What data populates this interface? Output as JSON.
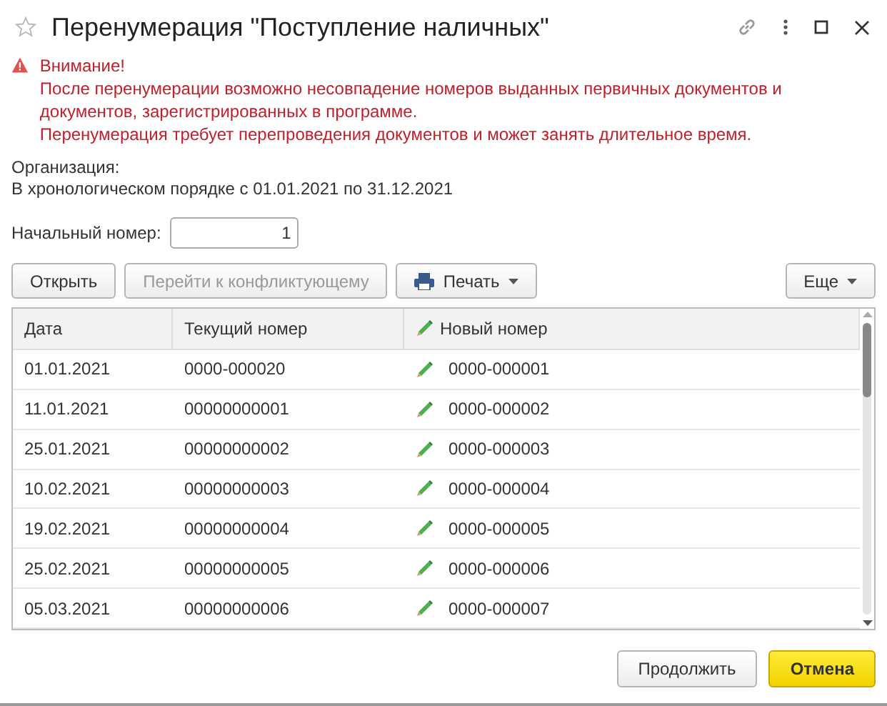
{
  "window": {
    "title": "Перенумерация \"Поступление наличных\""
  },
  "warning": {
    "lines": [
      "Внимание!",
      "После перенумерации возможно несовпадение номеров выданных первичных документов и документов, зарегистрированных в программе.",
      "Перенумерация требует перепроведения документов и может занять длительное время."
    ]
  },
  "organization": {
    "label": "Организация:"
  },
  "period": "В хронологическом порядке с 01.01.2021 по 31.12.2021",
  "start_number": {
    "label": "Начальный номер:",
    "value": "1"
  },
  "toolbar": [
    {
      "label": "Открыть",
      "kind": "plain",
      "disabled": false
    },
    {
      "label": "Перейти к конфликтующему",
      "kind": "plain",
      "disabled": true
    },
    {
      "label": "Печать",
      "kind": "print",
      "disabled": false
    },
    {
      "label": "Еще",
      "kind": "more",
      "disabled": false
    }
  ],
  "table": {
    "columns": [
      {
        "label": "Дата",
        "editable": false
      },
      {
        "label": "Текущий номер",
        "editable": false
      },
      {
        "label": "Новый номер",
        "editable": true
      }
    ],
    "rows": [
      [
        "01.01.2021",
        "0000-000020",
        "0000-000001"
      ],
      [
        "11.01.2021",
        "00000000001",
        "0000-000002"
      ],
      [
        "25.01.2021",
        "00000000002",
        "0000-000003"
      ],
      [
        "10.02.2021",
        "00000000003",
        "0000-000004"
      ],
      [
        "19.02.2021",
        "00000000004",
        "0000-000005"
      ],
      [
        "25.02.2021",
        "00000000005",
        "0000-000006"
      ],
      [
        "05.03.2021",
        "00000000006",
        "0000-000007"
      ]
    ]
  },
  "footer": [
    {
      "label": "Продолжить",
      "default": false
    },
    {
      "label": "Отмена",
      "default": true
    }
  ]
}
